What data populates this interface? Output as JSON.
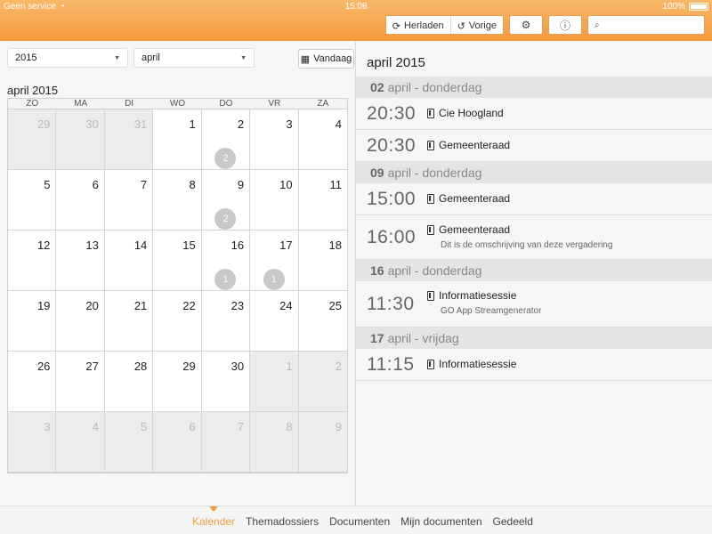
{
  "status": {
    "carrier": "Geen service",
    "time": "15:08",
    "battery": "100%"
  },
  "toolbar": {
    "reload": "Herladen",
    "previous": "Vorige"
  },
  "selects": {
    "year": "2015",
    "month": "april"
  },
  "today_button": "Vandaag",
  "calendar": {
    "title": "april 2015",
    "weekdays": [
      "ZO",
      "MA",
      "DI",
      "WO",
      "DO",
      "VR",
      "ZA"
    ],
    "days": [
      {
        "n": "29",
        "out": true
      },
      {
        "n": "30",
        "out": true
      },
      {
        "n": "31",
        "out": true
      },
      {
        "n": "1"
      },
      {
        "n": "2",
        "badge": "2"
      },
      {
        "n": "3"
      },
      {
        "n": "4"
      },
      {
        "n": "5"
      },
      {
        "n": "6"
      },
      {
        "n": "7"
      },
      {
        "n": "8"
      },
      {
        "n": "9",
        "badge": "2"
      },
      {
        "n": "10"
      },
      {
        "n": "11"
      },
      {
        "n": "12"
      },
      {
        "n": "13"
      },
      {
        "n": "14"
      },
      {
        "n": "15"
      },
      {
        "n": "16",
        "badge": "1"
      },
      {
        "n": "17",
        "badge": "1"
      },
      {
        "n": "18"
      },
      {
        "n": "19"
      },
      {
        "n": "20"
      },
      {
        "n": "21"
      },
      {
        "n": "22"
      },
      {
        "n": "23"
      },
      {
        "n": "24"
      },
      {
        "n": "25"
      },
      {
        "n": "26"
      },
      {
        "n": "27"
      },
      {
        "n": "28"
      },
      {
        "n": "29"
      },
      {
        "n": "30"
      },
      {
        "n": "1",
        "out": true
      },
      {
        "n": "2",
        "out": true
      },
      {
        "n": "3",
        "out": true
      },
      {
        "n": "4",
        "out": true
      },
      {
        "n": "5",
        "out": true
      },
      {
        "n": "6",
        "out": true
      },
      {
        "n": "7",
        "out": true
      },
      {
        "n": "8",
        "out": true
      },
      {
        "n": "9",
        "out": true
      }
    ]
  },
  "agenda": {
    "title": "april 2015",
    "groups": [
      {
        "day": "02",
        "label": "april - donderdag",
        "events": [
          {
            "time": "20:30",
            "title": "Cie Hoogland"
          },
          {
            "time": "20:30",
            "title": "Gemeenteraad"
          }
        ]
      },
      {
        "day": "09",
        "label": "april - donderdag",
        "events": [
          {
            "time": "15:00",
            "title": "Gemeenteraad"
          },
          {
            "time": "16:00",
            "title": "Gemeenteraad",
            "desc": "Dit is de omschrijving van deze vergadering"
          }
        ]
      },
      {
        "day": "16",
        "label": "april - donderdag",
        "events": [
          {
            "time": "11:30",
            "title": "Informatiesessie",
            "desc": "GO App Streamgenerator"
          }
        ]
      },
      {
        "day": "17",
        "label": "april - vrijdag",
        "events": [
          {
            "time": "11:15",
            "title": "Informatiesessie"
          }
        ]
      }
    ]
  },
  "tabs": [
    "Kalender",
    "Themadossiers",
    "Documenten",
    "Mijn documenten",
    "Gedeeld"
  ],
  "active_tab": "Kalender",
  "colors": {
    "accent": "#f39a3c"
  }
}
